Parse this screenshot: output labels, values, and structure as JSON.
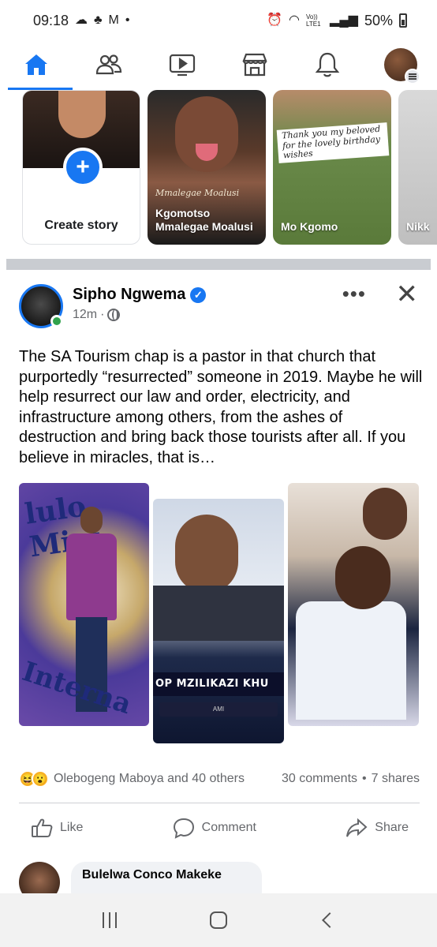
{
  "status_bar": {
    "time": "09:18",
    "left_icons": [
      "cloud-icon",
      "notification-icon",
      "gmail-icon",
      "dot-icon"
    ],
    "right_icons": [
      "alarm-icon",
      "wifi-icon",
      "volte-icon",
      "signal-icon"
    ],
    "volte_label": "Vo)) LTE1",
    "battery": "50%"
  },
  "nav": {
    "tabs": [
      "home",
      "friends",
      "video",
      "marketplace",
      "notifications",
      "profile-menu"
    ],
    "active": "home",
    "accent": "#1877f2"
  },
  "stories": [
    {
      "label": "Create story",
      "type": "create"
    },
    {
      "label": "Kgomotso Mmalegae Moalusi",
      "line1": "Kgomotso",
      "line2": "Mmalegae Moalusi",
      "overlay": "Mmalegae Moalusi"
    },
    {
      "label": "Mo Kgomo",
      "caption": "Thank you my beloved for the lovely birthday wishes"
    },
    {
      "label": "Nikk"
    }
  ],
  "post": {
    "author": "Sipho Ngwema",
    "verified": true,
    "time": "12m",
    "privacy": "public",
    "text": "The SA Tourism chap is a pastor in that church that purportedly “resurrected” someone in 2019. Maybe he will help resurrect our law and order, electricity, and infrastructure among others, from the ashes of destruction and bring back those tourists after all. If you believe in miracles, that is…",
    "images": [
      {
        "overlay_top": "lulo Mini",
        "overlay_bottom": "Interna"
      },
      {
        "banner": "OP MZILIKAZI KHU",
        "sub_banner": "AMI"
      },
      {}
    ],
    "reactions": {
      "icons": [
        "😆",
        "😮"
      ],
      "summary": "Olebogeng Maboya and 40 others",
      "comments": "30 comments",
      "separator": "•",
      "shares": "7 shares"
    },
    "actions": {
      "like": "Like",
      "comment": "Comment",
      "share": "Share"
    }
  },
  "comment_preview": {
    "name": "Bulelwa Conco Makeke"
  },
  "android_nav": [
    "recents",
    "home",
    "back"
  ]
}
